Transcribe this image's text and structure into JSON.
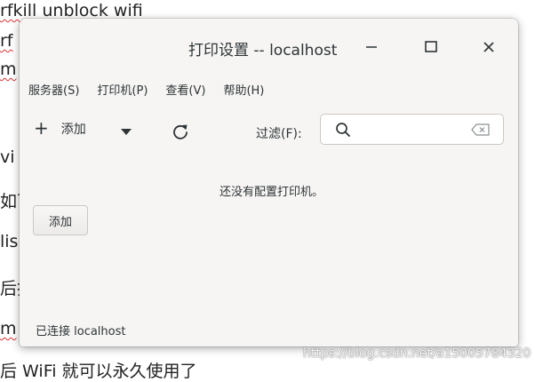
{
  "background_terminal": {
    "lines": [
      {
        "text": "rfkill unblock wifi"
      },
      {
        "text": "rf"
      },
      {
        "text": "m"
      },
      {
        "text": "vi"
      },
      {
        "text": "如下"
      },
      {
        "text": "lis"
      },
      {
        "text": "后执"
      },
      {
        "text": "m"
      },
      {
        "text": "后 WiFi 就可以永久使用了"
      }
    ]
  },
  "window": {
    "title": "打印设置 -- localhost",
    "controls": {
      "minimize_icon": "minimize-icon",
      "maximize_icon": "maximize-icon",
      "close_icon": "close-icon"
    }
  },
  "menubar": {
    "items": [
      {
        "label": "服务器(S)"
      },
      {
        "label": "打印机(P)"
      },
      {
        "label": "查看(V)"
      },
      {
        "label": "帮助(H)"
      }
    ]
  },
  "toolbar": {
    "add_label": "添加",
    "filter_label": "过滤(F):",
    "search_value": "",
    "search_placeholder": ""
  },
  "main": {
    "empty_message": "还没有配置打印机。",
    "add_button_label": "添加"
  },
  "statusbar": {
    "text": "已连接 localhost"
  },
  "watermark": {
    "text": "https://blog.csdn.net/a15005784320"
  },
  "colors": {
    "window_bg": "#f6f5f4",
    "text": "#2e3436",
    "border": "#cdc7c2"
  }
}
